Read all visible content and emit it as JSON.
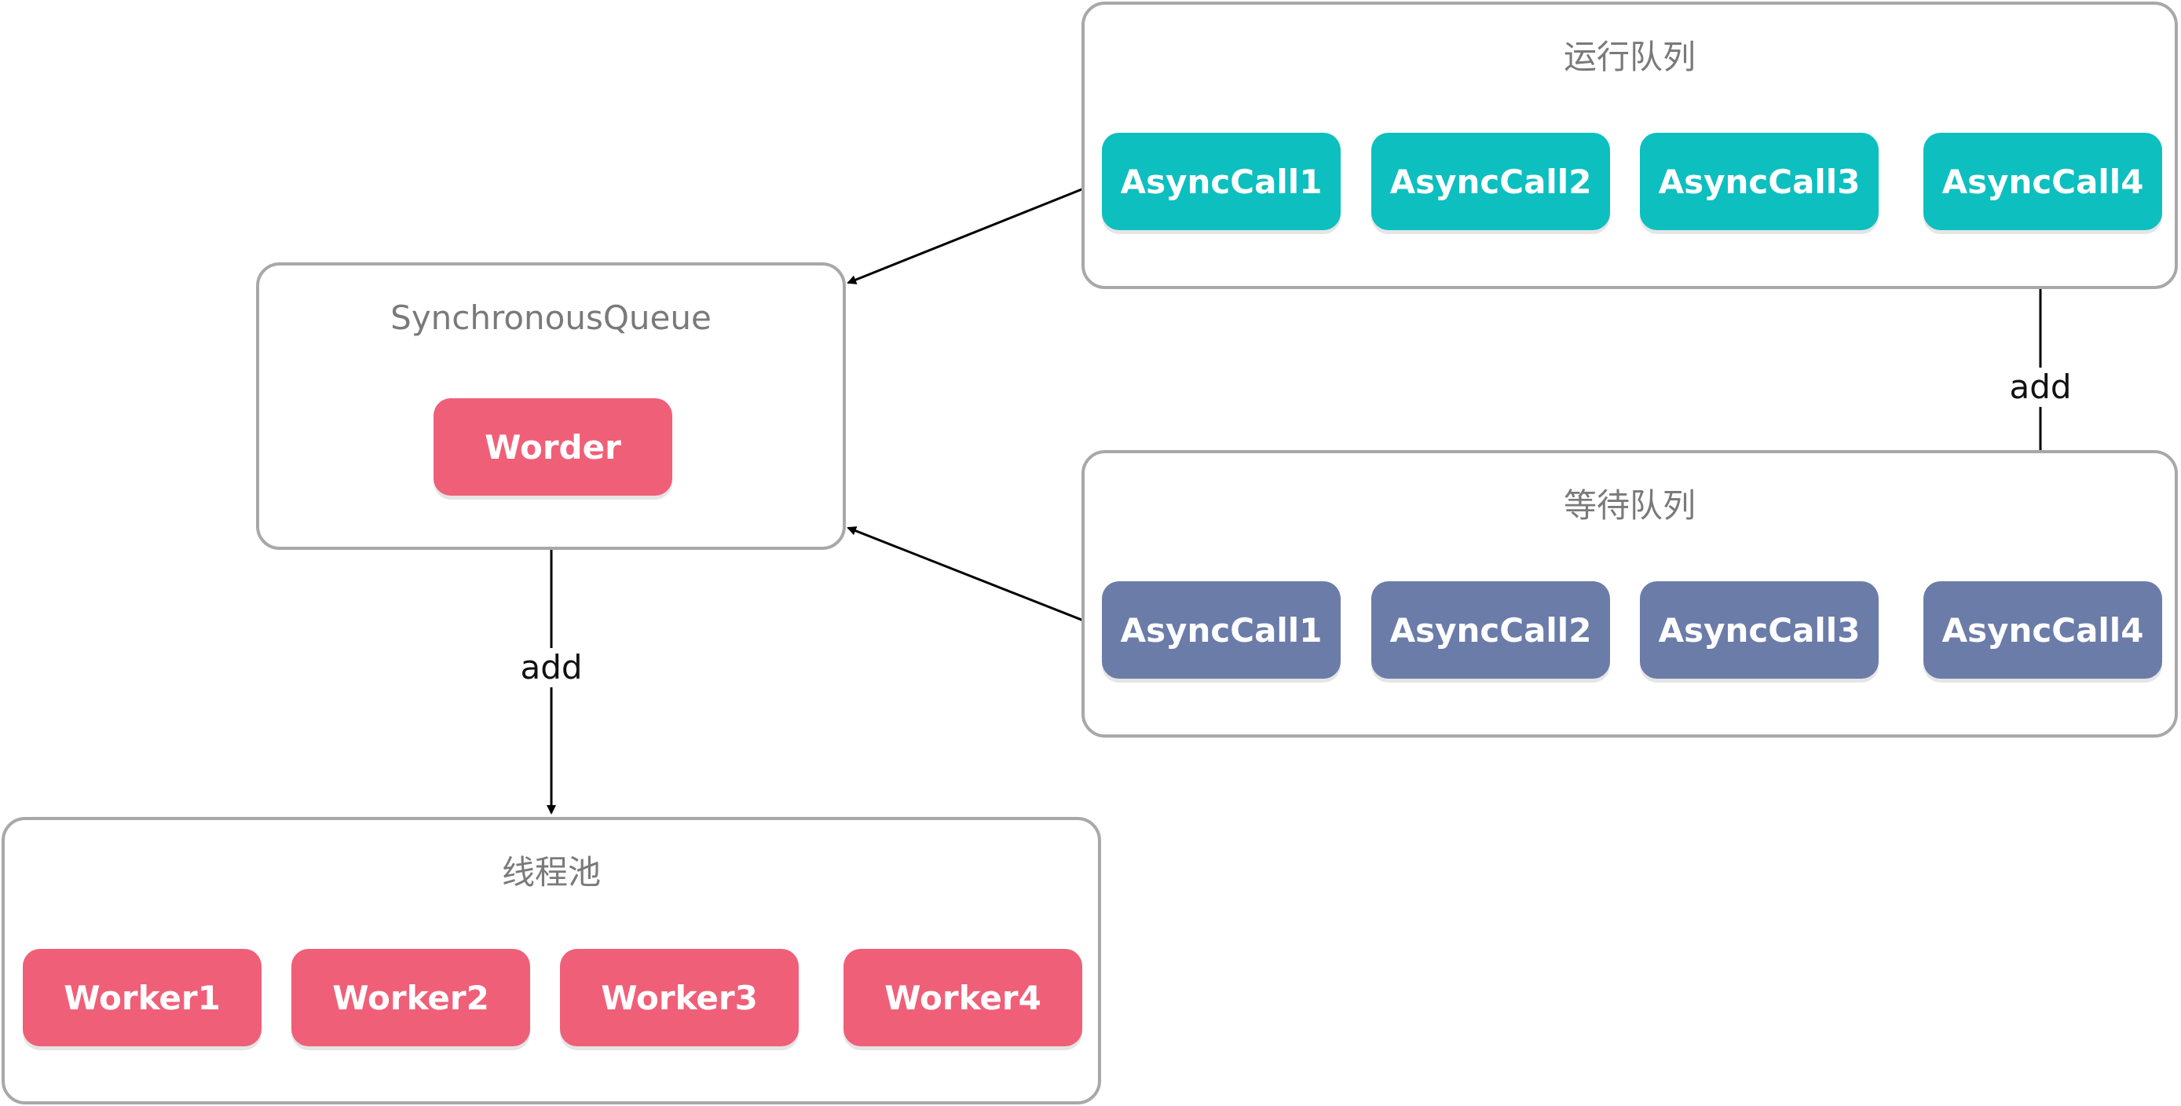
{
  "groups": {
    "running": {
      "title": "运行队列",
      "items": [
        "AsyncCall1",
        "AsyncCall2",
        "AsyncCall3",
        "AsyncCall4"
      ]
    },
    "waiting": {
      "title": "等待队列",
      "items": [
        "AsyncCall1",
        "AsyncCall2",
        "AsyncCall3",
        "AsyncCall4"
      ]
    },
    "sync_queue": {
      "title": "SynchronousQueue",
      "items": [
        "Worder"
      ]
    },
    "thread_pool": {
      "title": "线程池",
      "items": [
        "Worker1",
        "Worker2",
        "Worker3",
        "Worker4"
      ]
    }
  },
  "edge_labels": {
    "waiting_to_running": "add",
    "queue_to_pool": "add"
  },
  "colors": {
    "pink": "#f05f78",
    "teal": "#0dbfbf",
    "slate": "#6b7ca8",
    "border": "#a8a8a8"
  }
}
